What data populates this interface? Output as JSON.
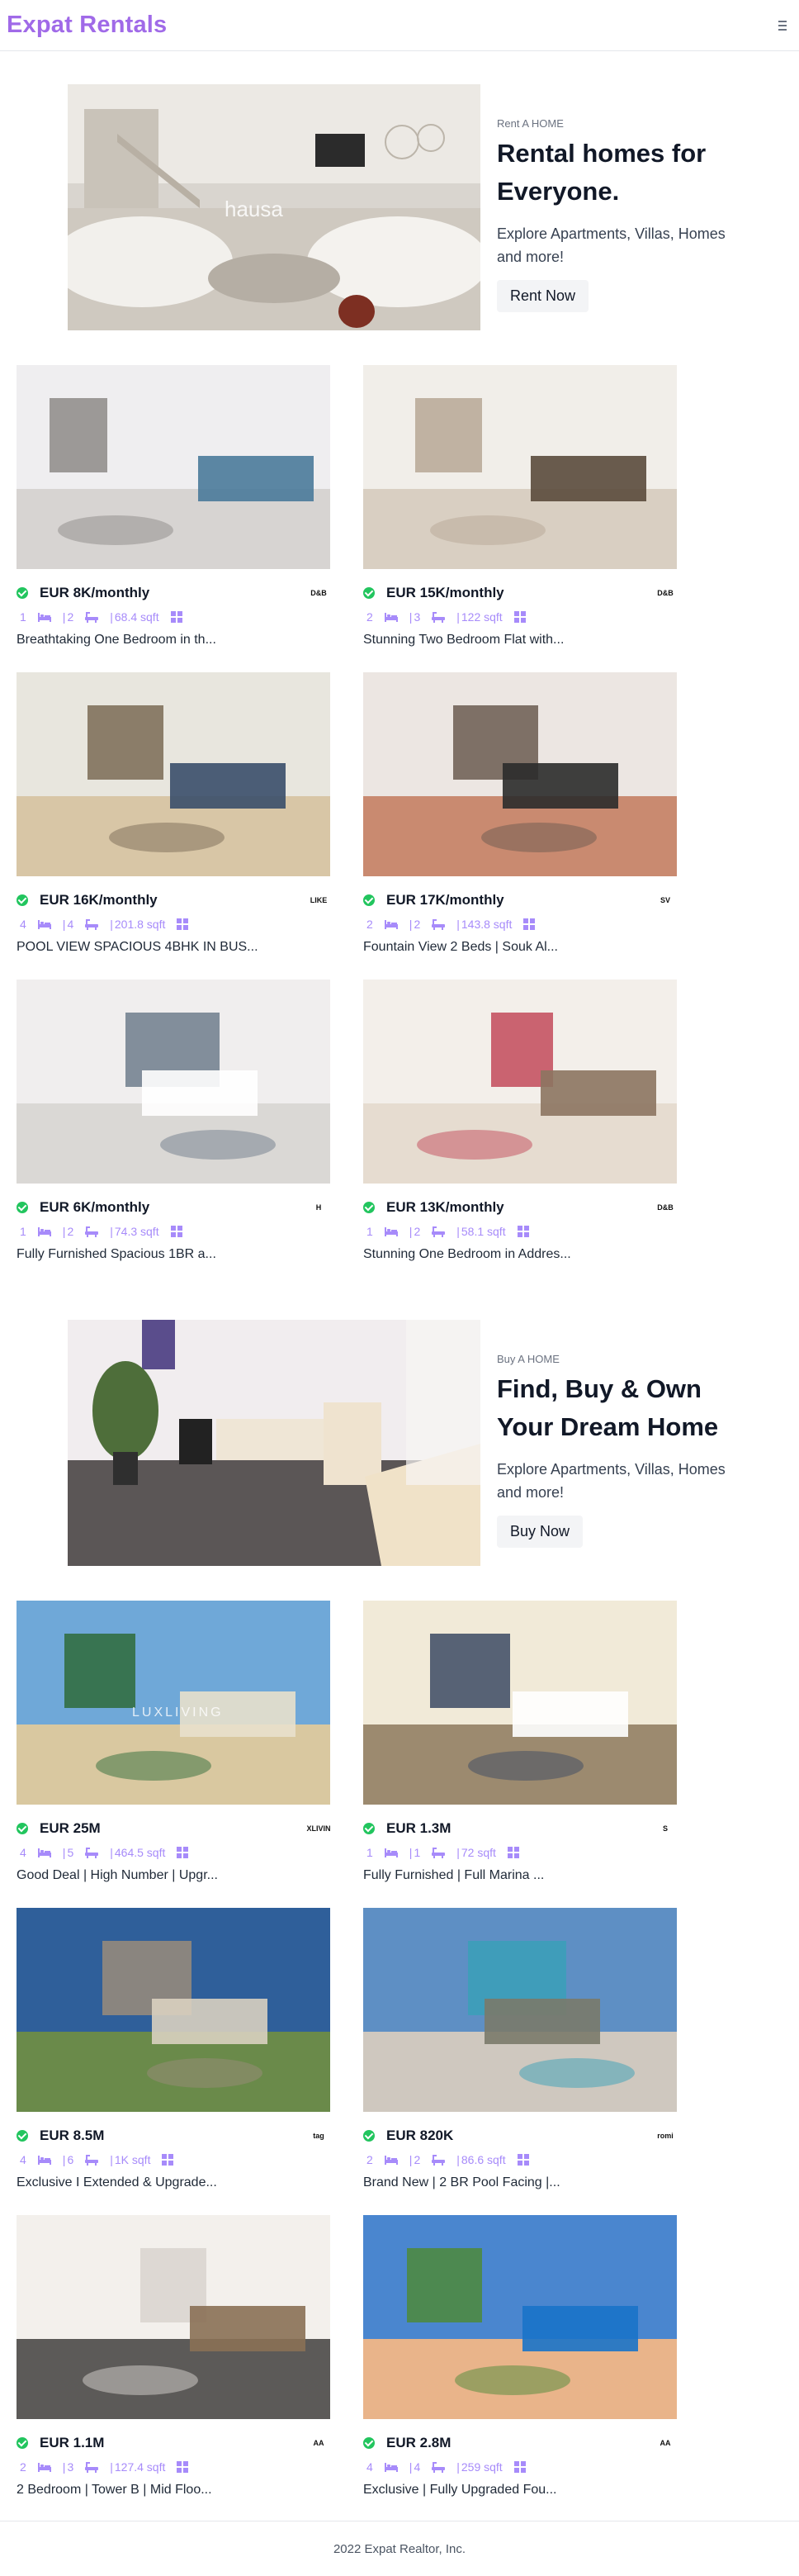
{
  "app": {
    "brand": "Expat Rentals"
  },
  "rent_hero": {
    "eyebrow": "Rent A HOME",
    "title": "Rental homes for Everyone.",
    "description": "Explore Apartments, Villas, Homes and more!",
    "button": "Rent Now",
    "watermark": "hausa"
  },
  "buy_hero": {
    "eyebrow": "Buy A HOME",
    "title": "Find, Buy & Own Your Dream Home",
    "description": "Explore Apartments, Villas, Homes and more!",
    "button": "Buy Now"
  },
  "rent_listings": [
    {
      "price": "EUR 8K/monthly",
      "beds": "1",
      "baths": "2",
      "area": "68.4 sqft",
      "title": "Breathtaking One Bedroom in th...",
      "logo": "D&B"
    },
    {
      "price": "EUR 15K/monthly",
      "beds": "2",
      "baths": "3",
      "area": "122 sqft",
      "title": "Stunning Two Bedroom Flat with...",
      "logo": "D&B"
    },
    {
      "price": "EUR 16K/monthly",
      "beds": "4",
      "baths": "4",
      "area": "201.8 sqft",
      "title": "POOL VIEW SPACIOUS 4BHK IN BUS...",
      "logo": "LIKE"
    },
    {
      "price": "EUR 17K/monthly",
      "beds": "2",
      "baths": "2",
      "area": "143.8 sqft",
      "title": "Fountain View 2 Beds | Souk Al...",
      "logo": "SV"
    },
    {
      "price": "EUR 6K/monthly",
      "beds": "1",
      "baths": "2",
      "area": "74.3 sqft",
      "title": "Fully Furnished Spacious 1BR a...",
      "logo": "H"
    },
    {
      "price": "EUR 13K/monthly",
      "beds": "1",
      "baths": "2",
      "area": "58.1 sqft",
      "title": "Stunning One Bedroom in Addres...",
      "logo": "D&B"
    }
  ],
  "buy_listings": [
    {
      "price": "EUR 25M",
      "beds": "4",
      "baths": "5",
      "area": "464.5 sqft",
      "title": "Good Deal | High Number | Upgr...",
      "logo": "XLIVIN",
      "watermark": "LUXLIVING"
    },
    {
      "price": "EUR 1.3M",
      "beds": "1",
      "baths": "1",
      "area": "72 sqft",
      "title": "Fully Furnished | Full Marina ...",
      "logo": "S"
    },
    {
      "price": "EUR 8.5M",
      "beds": "4",
      "baths": "6",
      "area": "1K sqft",
      "title": "Exclusive I Extended & Upgrade...",
      "logo": "tag"
    },
    {
      "price": "EUR 820K",
      "beds": "2",
      "baths": "2",
      "area": "86.6 sqft",
      "title": "Brand New | 2 BR Pool Facing |...",
      "logo": "romi"
    },
    {
      "price": "EUR 1.1M",
      "beds": "2",
      "baths": "3",
      "area": "127.4 sqft",
      "title": "2 Bedroom | Tower B | Mid Floo...",
      "logo": "AA"
    },
    {
      "price": "EUR 2.8M",
      "beds": "4",
      "baths": "4",
      "area": "259 sqft",
      "title": "Exclusive | Fully Upgraded Fou...",
      "logo": "AA"
    }
  ],
  "footer": {
    "text": "2022 Expat Realtor, Inc."
  },
  "icons": {
    "bed": "bed-icon",
    "bath": "bath-icon",
    "area": "area-grid-icon",
    "verified": "verified-check-icon",
    "menu": "hamburger-menu-icon"
  },
  "colors": {
    "brand": "#a06ae8",
    "meta": "#a78bfa",
    "verified": "#22c55e"
  }
}
